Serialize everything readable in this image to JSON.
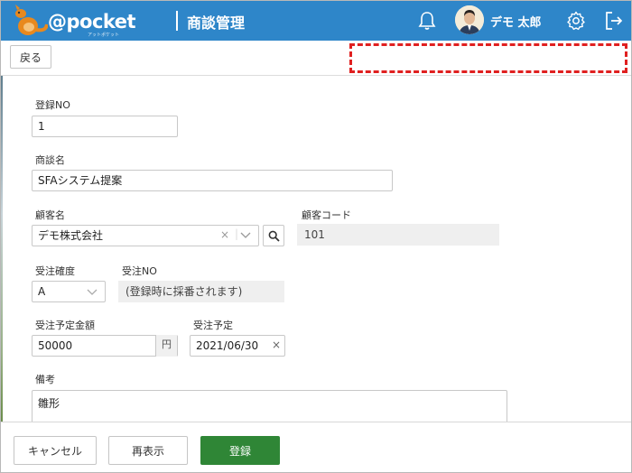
{
  "header": {
    "brand": "@pocket",
    "brand_sub": "アットポケット",
    "title": "商談管理",
    "user_name": "デモ 太郎",
    "icons": [
      "bell-icon",
      "gear-icon",
      "logout-icon"
    ]
  },
  "toolbar": {
    "back_label": "戻る"
  },
  "form": {
    "reg_no_label": "登録NO",
    "reg_no_value": "1",
    "deal_name_label": "商談名",
    "deal_name_value": "SFAシステム提案",
    "customer_label": "顧客名",
    "customer_value": "デモ株式会社",
    "customer_code_label": "顧客コード",
    "customer_code_value": "101",
    "order_certainty_label": "受注確度",
    "order_certainty_value": "A",
    "order_no_label": "受注NO",
    "order_no_value": "(登録時に採番されます)",
    "expected_amount_label": "受注予定金額",
    "expected_amount_value": "50000",
    "expected_amount_unit": "円",
    "expected_date_label": "受注予定",
    "expected_date_value": "2021/06/30",
    "remarks_label": "備考",
    "remarks_value": "雛形"
  },
  "footer": {
    "cancel_label": "キャンセル",
    "redisplay_label": "再表示",
    "register_label": "登録"
  },
  "colors": {
    "header_bg": "#2e86c9",
    "primary_button": "#2f8636",
    "highlight_dashed": "#e02020"
  }
}
